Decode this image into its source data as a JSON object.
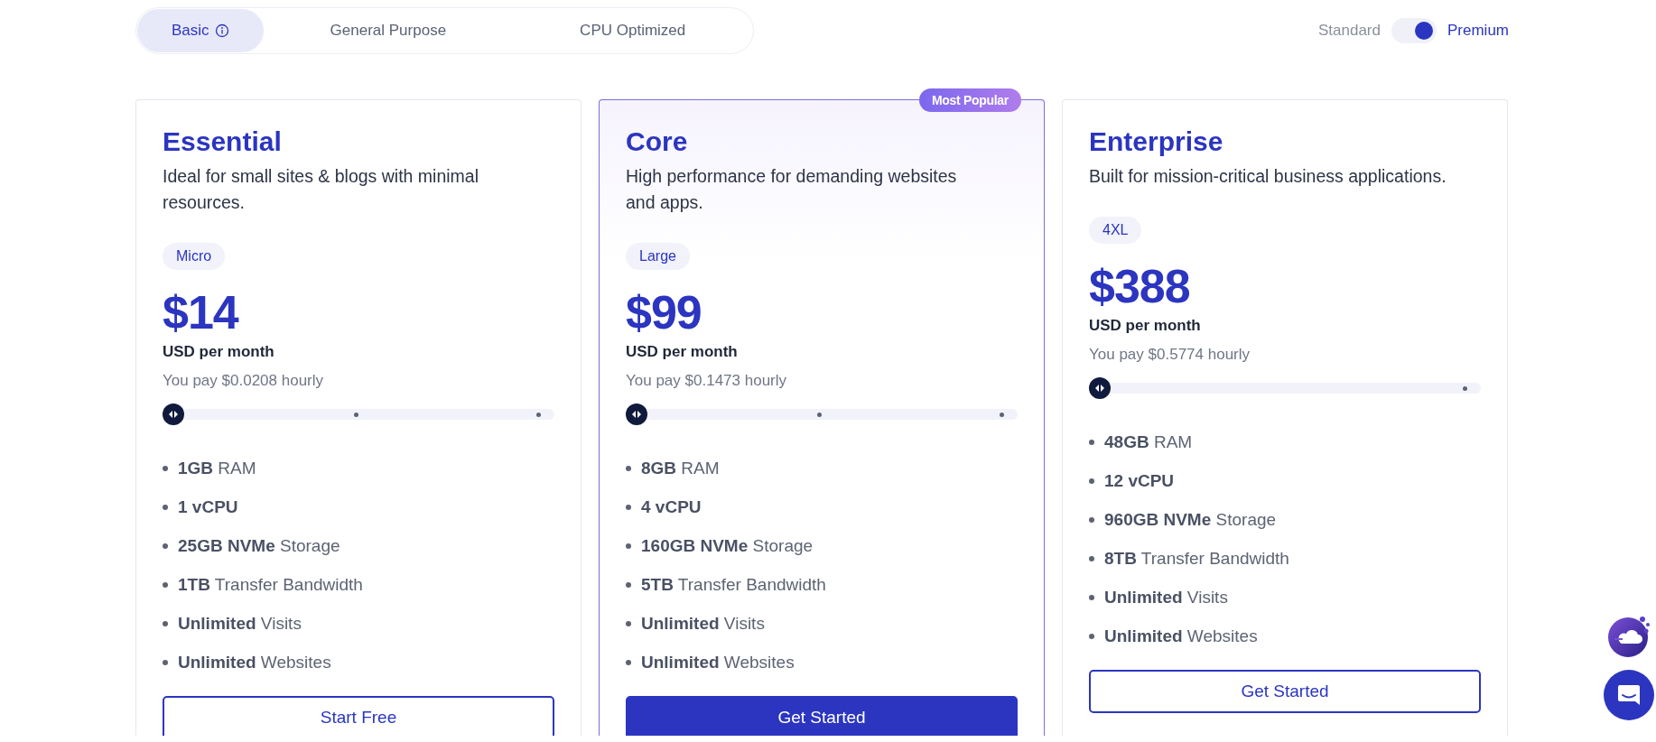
{
  "plan_tabs": [
    {
      "label": "Basic",
      "selected": true,
      "info": true
    },
    {
      "label": "General Purpose",
      "selected": false,
      "info": false
    },
    {
      "label": "CPU Optimized",
      "selected": false,
      "info": false
    }
  ],
  "tier_toggle": {
    "left_label": "Standard",
    "right_label": "Premium",
    "on": true
  },
  "cards": [
    {
      "title": "Essential",
      "description": "Ideal for small sites & blogs with minimal resources.",
      "size": "Micro",
      "price": "$14",
      "period": "USD per month",
      "hourly": "You pay $0.0208 hourly",
      "featured": false,
      "stops": [
        {
          "selected": true
        },
        {
          "selected": false
        },
        {
          "selected": false
        }
      ],
      "features": [
        "**1GB** RAM",
        "**1 vCPU**",
        "**25GB NVMe** Storage",
        "**1TB** Transfer Bandwidth",
        "**Unlimited** Visits",
        "**Unlimited** Websites"
      ],
      "button": {
        "label": "Start Free",
        "filled": false
      }
    },
    {
      "title": "Core",
      "badge": "Most Popular",
      "description": "High performance for demanding websites and apps.",
      "size": "Large",
      "price": "$99",
      "period": "USD per month",
      "hourly": "You pay $0.1473 hourly",
      "featured": true,
      "stops": [
        {
          "selected": true
        },
        {
          "selected": false
        },
        {
          "selected": false
        }
      ],
      "features": [
        "**8GB** RAM",
        "**4 vCPU**",
        "**160GB NVMe** Storage",
        "**5TB** Transfer Bandwidth",
        "**Unlimited** Visits",
        "**Unlimited** Websites"
      ],
      "button": {
        "label": "Get Started",
        "filled": true
      }
    },
    {
      "title": "Enterprise",
      "description": "Built for mission-critical business applications.",
      "size": "4XL",
      "price": "$388",
      "period": "USD per month",
      "hourly": "You pay $0.5774 hourly",
      "featured": false,
      "stops": [
        {
          "selected": true
        },
        {
          "selected": false
        }
      ],
      "features": [
        "**48GB** RAM",
        "**12 vCPU**",
        "**960GB NVMe** Storage",
        "**8TB** Transfer Bandwidth",
        "**Unlimited** Visits",
        "**Unlimited** Websites"
      ],
      "button": {
        "label": "Get Started",
        "filled": false
      }
    }
  ]
}
